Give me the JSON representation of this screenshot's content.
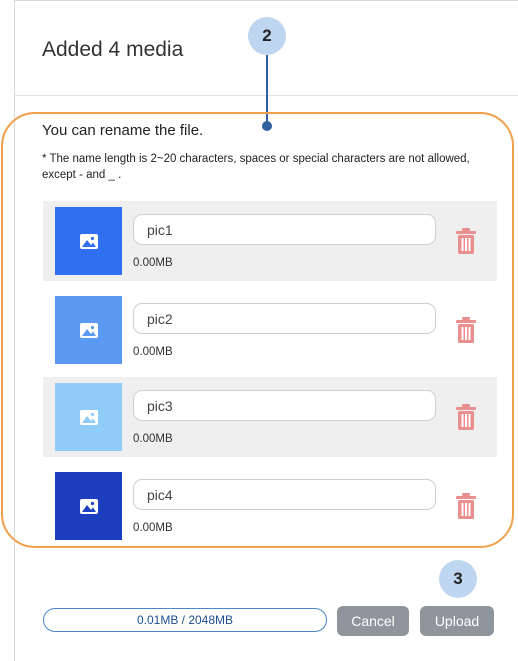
{
  "dialog": {
    "title": "Added 4 media",
    "rename_title": "You can rename the file.",
    "note": "* The name length is 2~20 characters, spaces or special characters are not allowed, except - and _ ."
  },
  "callouts": {
    "step2": "2",
    "step3": "3"
  },
  "files": [
    {
      "name": "pic1",
      "size": "0.00MB",
      "thumb_color": "#2f6ff0",
      "icon": "image-icon",
      "delete_icon": "trash-icon"
    },
    {
      "name": "pic2",
      "size": "0.00MB",
      "thumb_color": "#5a9af2",
      "icon": "image-icon",
      "delete_icon": "trash-icon"
    },
    {
      "name": "pic3",
      "size": "0.00MB",
      "thumb_color": "#8fcdf8",
      "icon": "image-icon",
      "delete_icon": "trash-icon"
    },
    {
      "name": "pic4",
      "size": "0.00MB",
      "thumb_color": "#1d3fbf",
      "icon": "image-icon",
      "delete_icon": "trash-icon"
    }
  ],
  "footer": {
    "usage": "0.01MB / 2048MB",
    "usage_fraction": 4.9e-06,
    "cancel_label": "Cancel",
    "upload_label": "Upload"
  },
  "colors": {
    "accent": "#4a86c8",
    "highlight": "#f0a04b",
    "callout": "#bed6f0",
    "trash": "#e98f8f",
    "button": "#8f959c"
  }
}
